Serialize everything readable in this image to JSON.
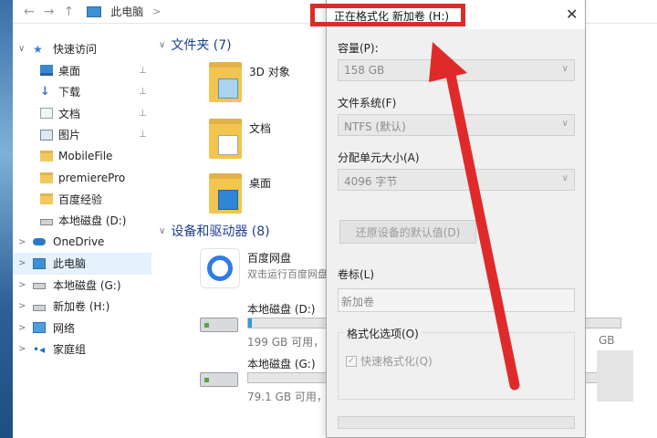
{
  "address": {
    "crumb": "此电脑",
    "sep": ">",
    "back_icon": "←",
    "forward_icon": "→",
    "up_icon": "↑"
  },
  "sidebar": {
    "items": [
      {
        "label": "快速访问",
        "icon": "star-icon",
        "level": 0,
        "chev": "∨"
      },
      {
        "label": "桌面",
        "icon": "desktop-icon",
        "level": 1,
        "pin": true
      },
      {
        "label": "下载",
        "icon": "download-icon",
        "level": 1,
        "pin": true
      },
      {
        "label": "文档",
        "icon": "document-icon",
        "level": 1,
        "pin": true
      },
      {
        "label": "图片",
        "icon": "picture-icon",
        "level": 1,
        "pin": true
      },
      {
        "label": "MobileFile",
        "icon": "folder-icon",
        "level": 1
      },
      {
        "label": "premierePro",
        "icon": "folder-icon",
        "level": 1
      },
      {
        "label": "百度经验",
        "icon": "folder-icon",
        "level": 1
      },
      {
        "label": "本地磁盘 (D:)",
        "icon": "drive-icon",
        "level": 1
      },
      {
        "label": "OneDrive",
        "icon": "cloud-icon",
        "level": 0,
        "chev": ">"
      },
      {
        "label": "此电脑",
        "icon": "computer-icon",
        "level": 0,
        "chev": ">",
        "selected": true
      },
      {
        "label": "本地磁盘 (G:)",
        "icon": "drive-icon",
        "level": 0,
        "chev": ">"
      },
      {
        "label": "新加卷 (H:)",
        "icon": "drive-icon",
        "level": 0,
        "chev": ">"
      },
      {
        "label": "网络",
        "icon": "network-icon",
        "level": 0,
        "chev": ">"
      },
      {
        "label": "家庭组",
        "icon": "homegroup-icon",
        "level": 0,
        "chev": ">"
      }
    ],
    "pin_glyph": "📌"
  },
  "main": {
    "folders_header": "文件夹 (7)",
    "folders": [
      {
        "name": "3D 对象"
      },
      {
        "name": "文档"
      },
      {
        "name": "桌面"
      }
    ],
    "devices_header": "设备和驱动器 (8)",
    "app": {
      "name": "百度网盘",
      "sub": "双击运行百度网盘"
    },
    "drives": [
      {
        "name": "本地磁盘 (D:)",
        "info": "199 GB 可用，",
        "used_fraction": 0.01
      },
      {
        "name": "本地磁盘 (G:)",
        "info": "79.1 GB 可用，",
        "used_fraction": 0.0
      }
    ],
    "partial_right": "GB"
  },
  "dialog": {
    "title": "正在格式化 新加卷 (H:)",
    "close_glyph": "✕",
    "capacity_label": "容量(P):",
    "capacity_value": "158 GB",
    "fs_label": "文件系统(F)",
    "fs_value": "NTFS (默认)",
    "alloc_label": "分配单元大小(A)",
    "alloc_value": "4096 字节",
    "restore_button": "还原设备的默认值(D)",
    "volume_label": "卷标(L)",
    "volume_value": "新加卷",
    "options_label": "格式化选项(O)",
    "quick_format": "快速格式化(Q)",
    "quick_format_checked": true,
    "dropdown_arrow": "∨",
    "check_glyph": "✓"
  },
  "annotation": {
    "color": "#e02a2a"
  }
}
